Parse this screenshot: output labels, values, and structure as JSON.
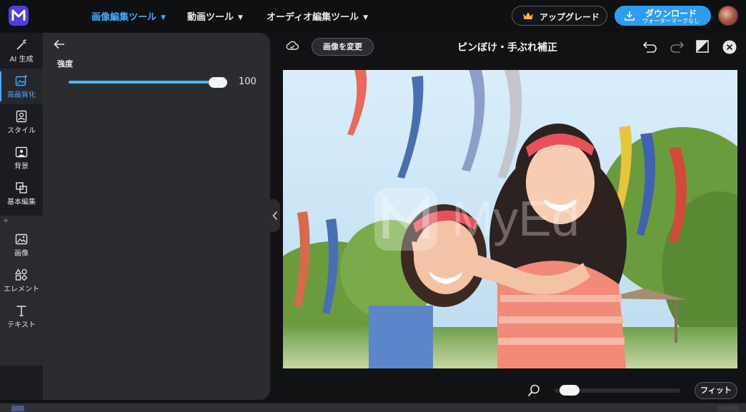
{
  "topnav": {
    "items": [
      {
        "label": "画像編集ツール",
        "active": true
      },
      {
        "label": "動画ツール",
        "active": false
      },
      {
        "label": "オーディオ編集ツール",
        "active": false
      }
    ],
    "upgrade_label": "アップグレード",
    "download_label": "ダウンロード",
    "download_sublabel": "ウォーターマークなし"
  },
  "rail": {
    "items": [
      {
        "label": "AI 生成",
        "icon": "magic-wand-icon"
      },
      {
        "label": "高画質化",
        "icon": "enhance-image-icon",
        "active": true
      },
      {
        "label": "スタイル",
        "icon": "style-icon"
      },
      {
        "label": "背景",
        "icon": "background-icon"
      },
      {
        "label": "基本編集",
        "icon": "crop-icon"
      },
      {
        "label": "画像",
        "icon": "image-icon"
      },
      {
        "label": "エレメント",
        "icon": "elements-icon"
      },
      {
        "label": "テキスト",
        "icon": "text-icon"
      }
    ],
    "add_symbol": "+"
  },
  "panel": {
    "strength_label": "強度",
    "strength_value": "100",
    "strength_max": 100
  },
  "canvas": {
    "change_image_label": "画像を変更",
    "title": "ピンぼけ・手ぶれ補正",
    "watermark": "MyEd"
  },
  "zoom": {
    "level": 0.05,
    "fit_label": "フィット"
  },
  "colors": {
    "accent": "#46a9ff",
    "download_bg": "#2e9cf0",
    "logo_bg": "#4a3fe0",
    "slider_fill": "#4fb2f5"
  }
}
